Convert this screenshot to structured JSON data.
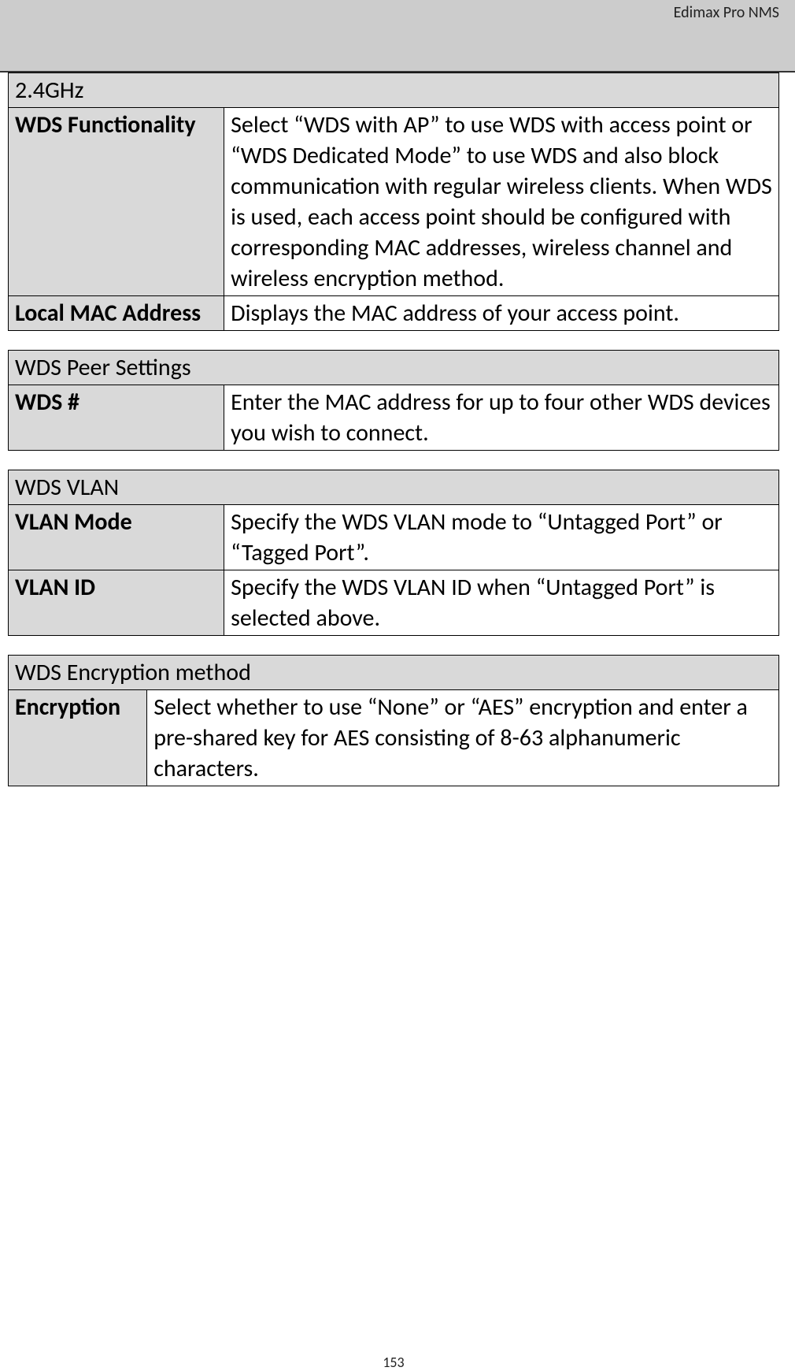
{
  "header": {
    "right_text": "Edimax Pro NMS"
  },
  "table1": {
    "title": "2.4GHz",
    "rows": [
      {
        "label": "WDS Functionality",
        "desc": "Select “WDS with AP” to use WDS with access point or “WDS Dedicated Mode” to use WDS and also block communication with regular wireless clients. When WDS is used, each access point should be configured with corresponding MAC addresses, wireless channel and wireless encryption method."
      },
      {
        "label": "Local MAC Address",
        "desc": "Displays the MAC address of your access point."
      }
    ]
  },
  "table2": {
    "title": "WDS Peer Settings",
    "rows": [
      {
        "label": "WDS #",
        "desc": "Enter the MAC address for up to four other WDS devices you wish to connect."
      }
    ]
  },
  "table3": {
    "title": "WDS VLAN",
    "rows": [
      {
        "label": "VLAN Mode",
        "desc": "Specify the WDS VLAN mode to “Untagged Port” or “Tagged Port”."
      },
      {
        "label": "VLAN ID",
        "desc": "Specify the WDS VLAN ID when “Untagged Port” is selected above."
      }
    ]
  },
  "table4": {
    "title": "WDS Encryption method",
    "rows": [
      {
        "label": "Encryption",
        "desc": "Select whether to use “None” or “AES” encryption and enter a pre-shared key for AES consisting of 8-63 alphanumeric characters."
      }
    ]
  },
  "page_number": "153"
}
